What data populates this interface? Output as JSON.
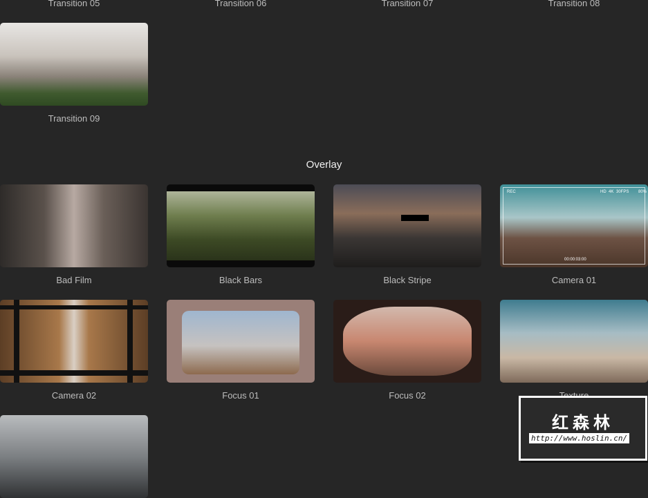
{
  "top_row": {
    "labels": [
      "Transition 05",
      "Transition 06",
      "Transition 07",
      "Transition 08"
    ]
  },
  "transition_09": {
    "label": "Transition 09"
  },
  "overlay": {
    "title": "Overlay",
    "items": [
      {
        "label": "Bad Film"
      },
      {
        "label": "Black Bars"
      },
      {
        "label": "Black Stripe"
      },
      {
        "label": "Camera 01"
      },
      {
        "label": "Camera 02"
      },
      {
        "label": "Focus 01"
      },
      {
        "label": "Focus 02"
      },
      {
        "label": "Texture"
      }
    ],
    "camera_hud": {
      "rec": "REC",
      "hd": "HD",
      "res": "4K",
      "fps": "30FPS",
      "battery": "80%",
      "timecode": "00:00:03:00"
    }
  },
  "watermark": {
    "title": "红森林",
    "url": "http://www.hoslin.cn/"
  }
}
